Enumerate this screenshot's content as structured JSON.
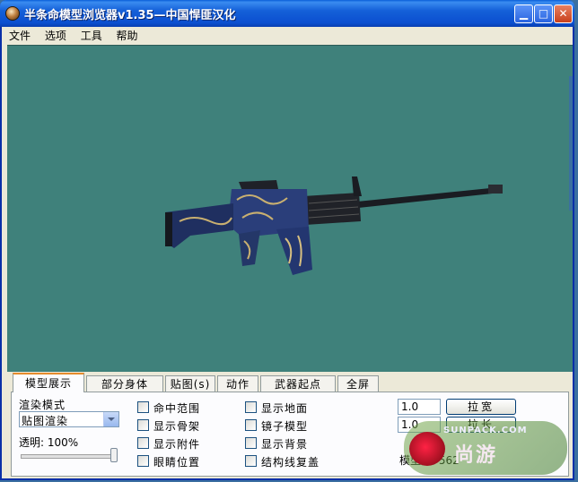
{
  "window": {
    "title": "半条命模型浏览器v1.35—中国悍匪汉化"
  },
  "menu": [
    "文件",
    "选项",
    "工具",
    "帮助"
  ],
  "tabs": [
    "模型展示",
    "部分身体",
    "贴图(s)",
    "动作",
    "武器起点",
    "全屏"
  ],
  "panel": {
    "render_mode_label": "渲染模式",
    "render_mode_value": "贴图渲染",
    "transparency_label": "透明: 100%",
    "transparency_value": 1.0,
    "checkboxes_col1": [
      "命中范围",
      "显示骨架",
      "显示附件",
      "眼睛位置"
    ],
    "checkboxes_col2": [
      "显示地面",
      "镜子模型",
      "显示背景",
      "结构线复盖"
    ],
    "input_width": "1.0",
    "input_length": "1.0",
    "btn_widen": "拉宽",
    "btn_lengthen": "拉长",
    "model_faces_label": "模型面: 562"
  },
  "watermark": {
    "site": "SUNPACK.COM",
    "logo": "尚游"
  },
  "colors": {
    "viewport_bg": "#3f817b",
    "titlebar": "#0b4fd0",
    "active_tab_accent": "#e68b2c"
  }
}
